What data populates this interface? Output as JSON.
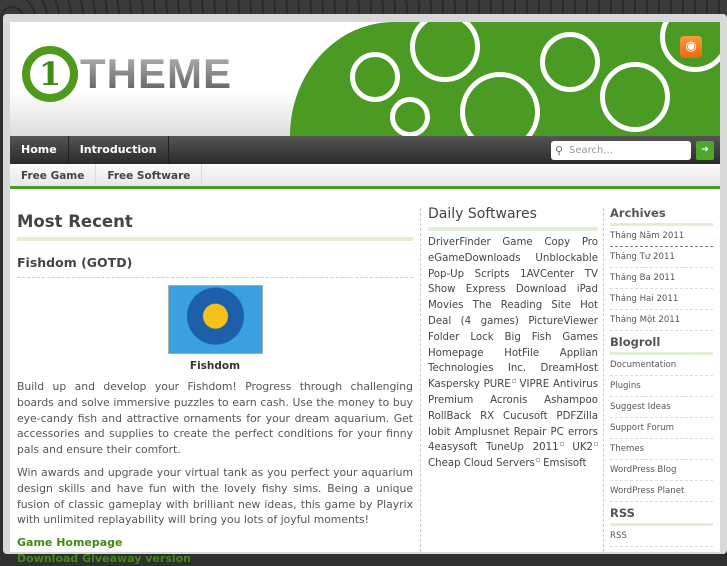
{
  "header": {
    "logo_mark": "1",
    "logo_text": "THEME",
    "rss_icon": "rss-icon"
  },
  "nav": {
    "items": [
      "Home",
      "Introduction"
    ],
    "search_placeholder": "Search...",
    "search_go": "➜"
  },
  "subnav": {
    "items": [
      "Free Game",
      "Free Software"
    ]
  },
  "main": {
    "heading": "Most Recent",
    "post_title": "Fishdom (GOTD)",
    "image_caption": "Fishdom",
    "paragraphs": [
      "Build up and develop your Fishdom! Progress through challenging boards and solve immersive puzzles to earn cash. Use the money to buy eye-candy fish and attractive ornaments for your dream aquarium. Get accessories and supplies to create the perfect conditions for your finny pals and ensure their comfort.",
      "Win awards and upgrade your virtual tank as you perfect your aquarium design skills and have fun with the lovely fishy sims. Being a unique fusion of classic gameplay with brilliant new ideas, this game by Playrix with unlimited replayability will bring you lots of joyful moments!"
    ],
    "links": [
      "Game Homepage",
      "Download Giveaway version"
    ]
  },
  "daily": {
    "heading": "Daily Softwares",
    "links": [
      "DriverFinder",
      "Game Copy Pro",
      "eGameDownloads",
      "Unblockable Pop-Up Scripts",
      "1AVCenter",
      "TV Show Express",
      "Download iPad Movies",
      "The Reading Site",
      "Hot Deal (4 games)",
      "PictureViewer",
      "Folder Lock",
      "Big Fish Games Homepage",
      "HotFile",
      "Applian Technologies Inc.",
      "DreamHost",
      "Kaspersky PURE",
      "VIPRE Antivirus Premium",
      "Acronis",
      "Ashampoo",
      "RollBack RX",
      "Cucusoft",
      "PDFZilla",
      "Iobit",
      "Amplusnet",
      "Repair PC errors",
      "4easysoft",
      "TuneUp 2011",
      "UK2",
      "Cheap Cloud Servers",
      "Emsisoft"
    ]
  },
  "sidebar": {
    "archives_heading": "Archives",
    "archives": [
      "Tháng Năm 2011",
      "Tháng Tư 2011",
      "Tháng Ba 2011",
      "Tháng Hai 2011",
      "Tháng Một 2011"
    ],
    "blogroll_heading": "Blogroll",
    "blogroll": [
      "Documentation",
      "Plugins",
      "Suggest Ideas",
      "Support Forum",
      "Themes",
      "WordPress Blog",
      "WordPress Planet"
    ],
    "rss_heading": "RSS",
    "rss": [
      "RSS"
    ]
  }
}
